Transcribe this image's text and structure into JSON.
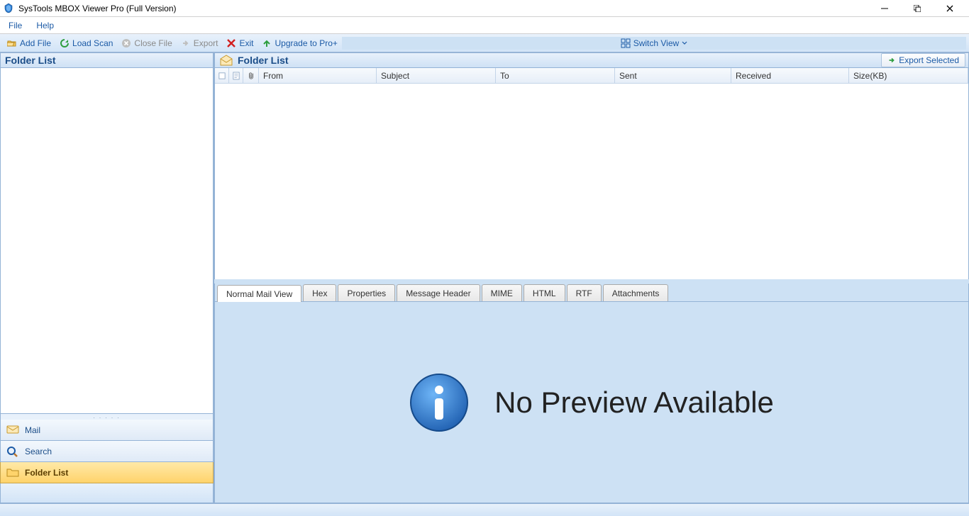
{
  "title": "SysTools MBOX Viewer Pro (Full Version)",
  "menubar": {
    "file": "File",
    "help": "Help"
  },
  "toolbar": {
    "add_file": "Add File",
    "load_scan": "Load Scan",
    "close_file": "Close File",
    "export": "Export",
    "exit": "Exit",
    "upgrade": "Upgrade to Pro+",
    "switch_view": "Switch View"
  },
  "left_panel": {
    "header": "Folder List",
    "nav": {
      "mail": "Mail",
      "search": "Search",
      "folder_list": "Folder List"
    }
  },
  "list_panel": {
    "header": "Folder List",
    "export_selected": "Export Selected",
    "columns": {
      "from": "From",
      "subject": "Subject",
      "to": "To",
      "sent": "Sent",
      "received": "Received",
      "size": "Size(KB)"
    }
  },
  "tabs": {
    "normal": "Normal Mail View",
    "hex": "Hex",
    "properties": "Properties",
    "message_header": "Message Header",
    "mime": "MIME",
    "html": "HTML",
    "rtf": "RTF",
    "attachments": "Attachments"
  },
  "preview": {
    "message": "No Preview Available"
  }
}
